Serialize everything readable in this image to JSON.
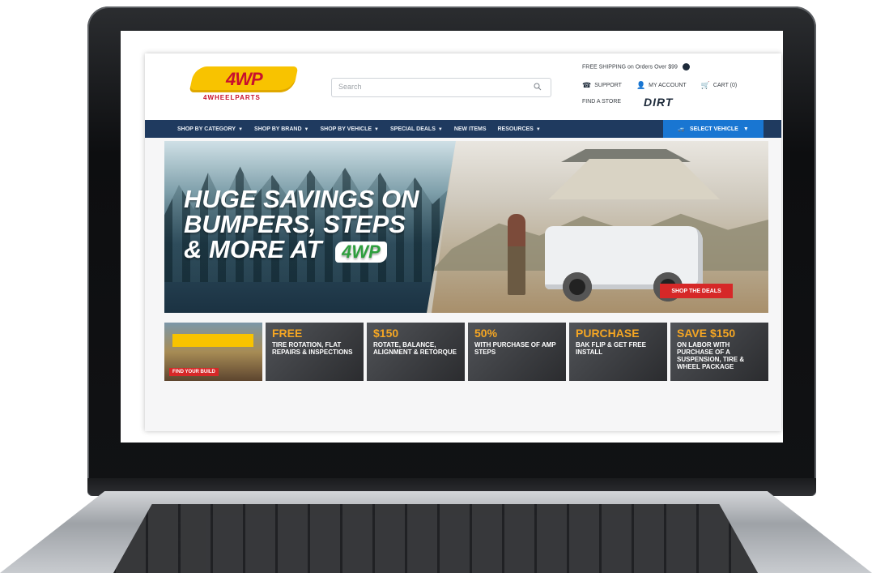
{
  "site": {
    "logo": {
      "name": "4WP",
      "subtitle": "4WHEELPARTS"
    },
    "search": {
      "placeholder": "Search"
    },
    "utility": {
      "top_text": "FREE SHIPPING on Orders Over $99",
      "items": [
        {
          "label": "SUPPORT",
          "icon": "phone-icon"
        },
        {
          "label": "MY ACCOUNT",
          "icon": "user-icon"
        },
        {
          "label": "CART (0)",
          "icon": "cart-icon"
        }
      ],
      "store_label": "FIND A STORE",
      "dirt_label": "DIRT"
    },
    "nav": {
      "items": [
        {
          "label": "SHOP BY CATEGORY"
        },
        {
          "label": "SHOP BY BRAND"
        },
        {
          "label": "SHOP BY VEHICLE"
        },
        {
          "label": "SPECIAL DEALS"
        },
        {
          "label": "NEW ITEMS"
        },
        {
          "label": "RESOURCES"
        }
      ],
      "select_vehicle": "SELECT VEHICLE"
    },
    "hero": {
      "headline_lines": [
        "HUGE SAVINGS ON",
        "BUMPERS, STEPS",
        "& MORE AT"
      ],
      "brand": "4WP",
      "cta": "SHOP THE DEALS"
    },
    "promos": [
      {
        "big": "",
        "text": "",
        "cta": "FIND YOUR BUILD"
      },
      {
        "big": "FREE",
        "text": "TIRE ROTATION, FLAT REPAIRS & INSPECTIONS",
        "cta": ""
      },
      {
        "big": "$150",
        "text": "ROTATE, BALANCE, ALIGNMENT & RETORQUE",
        "cta": ""
      },
      {
        "big": "50%",
        "text": "WITH PURCHASE OF AMP STEPS",
        "cta": ""
      },
      {
        "big": "PURCHASE",
        "text": "BAK FLIP & GET FREE INSTALL",
        "cta": ""
      },
      {
        "big": "SAVE $150",
        "text": "ON LABOR WITH PURCHASE OF A SUSPENSION, TIRE & WHEEL PACKAGE",
        "cta": ""
      }
    ]
  },
  "colors": {
    "nav_bg": "#1f3a5f",
    "accent_blue": "#1976d2",
    "brand_yellow": "#f8c300",
    "brand_red": "#c8102e",
    "cta_red": "#d62828"
  }
}
